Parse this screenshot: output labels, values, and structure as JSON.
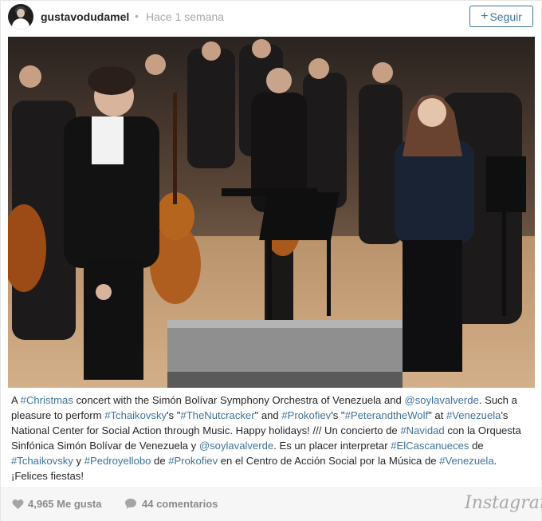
{
  "header": {
    "username": "gustavodudamel",
    "separator": "•",
    "time": "Hace 1 semana",
    "follow_label": "Seguir",
    "follow_icon": "+"
  },
  "photo": {
    "description": "Conductor and soloist on stage with orchestra"
  },
  "caption": {
    "segments": [
      {
        "text": "A ",
        "tag": false
      },
      {
        "text": "#Christmas",
        "tag": true
      },
      {
        "text": " concert with the Simón Bolívar Symphony Orchestra of Venezuela and ",
        "tag": false
      },
      {
        "text": "@soylavalverde",
        "tag": true
      },
      {
        "text": ". Such a pleasure to perform ",
        "tag": false
      },
      {
        "text": "#Tchaikovsky",
        "tag": true
      },
      {
        "text": "'s \"",
        "tag": false
      },
      {
        "text": "#TheNutcracker",
        "tag": true
      },
      {
        "text": "\" and ",
        "tag": false
      },
      {
        "text": "#Prokofiev",
        "tag": true
      },
      {
        "text": "'s \"",
        "tag": false
      },
      {
        "text": "#PeterandtheWolf",
        "tag": true
      },
      {
        "text": "\" at ",
        "tag": false
      },
      {
        "text": "#Venezuela",
        "tag": true
      },
      {
        "text": "'s National Center for Social Action through Music. Happy holidays! /// Un concierto de ",
        "tag": false
      },
      {
        "text": "#Navidad",
        "tag": true
      },
      {
        "text": " con la Orquesta Sinfónica Simón Bolívar de Venezuela y ",
        "tag": false
      },
      {
        "text": "@soylavalverde",
        "tag": true
      },
      {
        "text": ". Es un placer interpretar ",
        "tag": false
      },
      {
        "text": "#ElCascanueces",
        "tag": true
      },
      {
        "text": " de ",
        "tag": false
      },
      {
        "text": "#Tchaikovsky",
        "tag": true
      },
      {
        "text": " y ",
        "tag": false
      },
      {
        "text": "#Pedroyellobo",
        "tag": true
      },
      {
        "text": " de ",
        "tag": false
      },
      {
        "text": "#Prokofiev",
        "tag": true
      },
      {
        "text": " en el Centro de Acción Social por la Música de ",
        "tag": false
      },
      {
        "text": "#Venezuela",
        "tag": true
      },
      {
        "text": ". ¡Felices fiestas!",
        "tag": false
      }
    ]
  },
  "footer": {
    "likes": "4,965 Me gusta",
    "comments": "44 comentarios",
    "logo": "Instagram"
  },
  "colors": {
    "link": "#3f729b",
    "text": "#262626",
    "muted": "#a5a7aa"
  }
}
